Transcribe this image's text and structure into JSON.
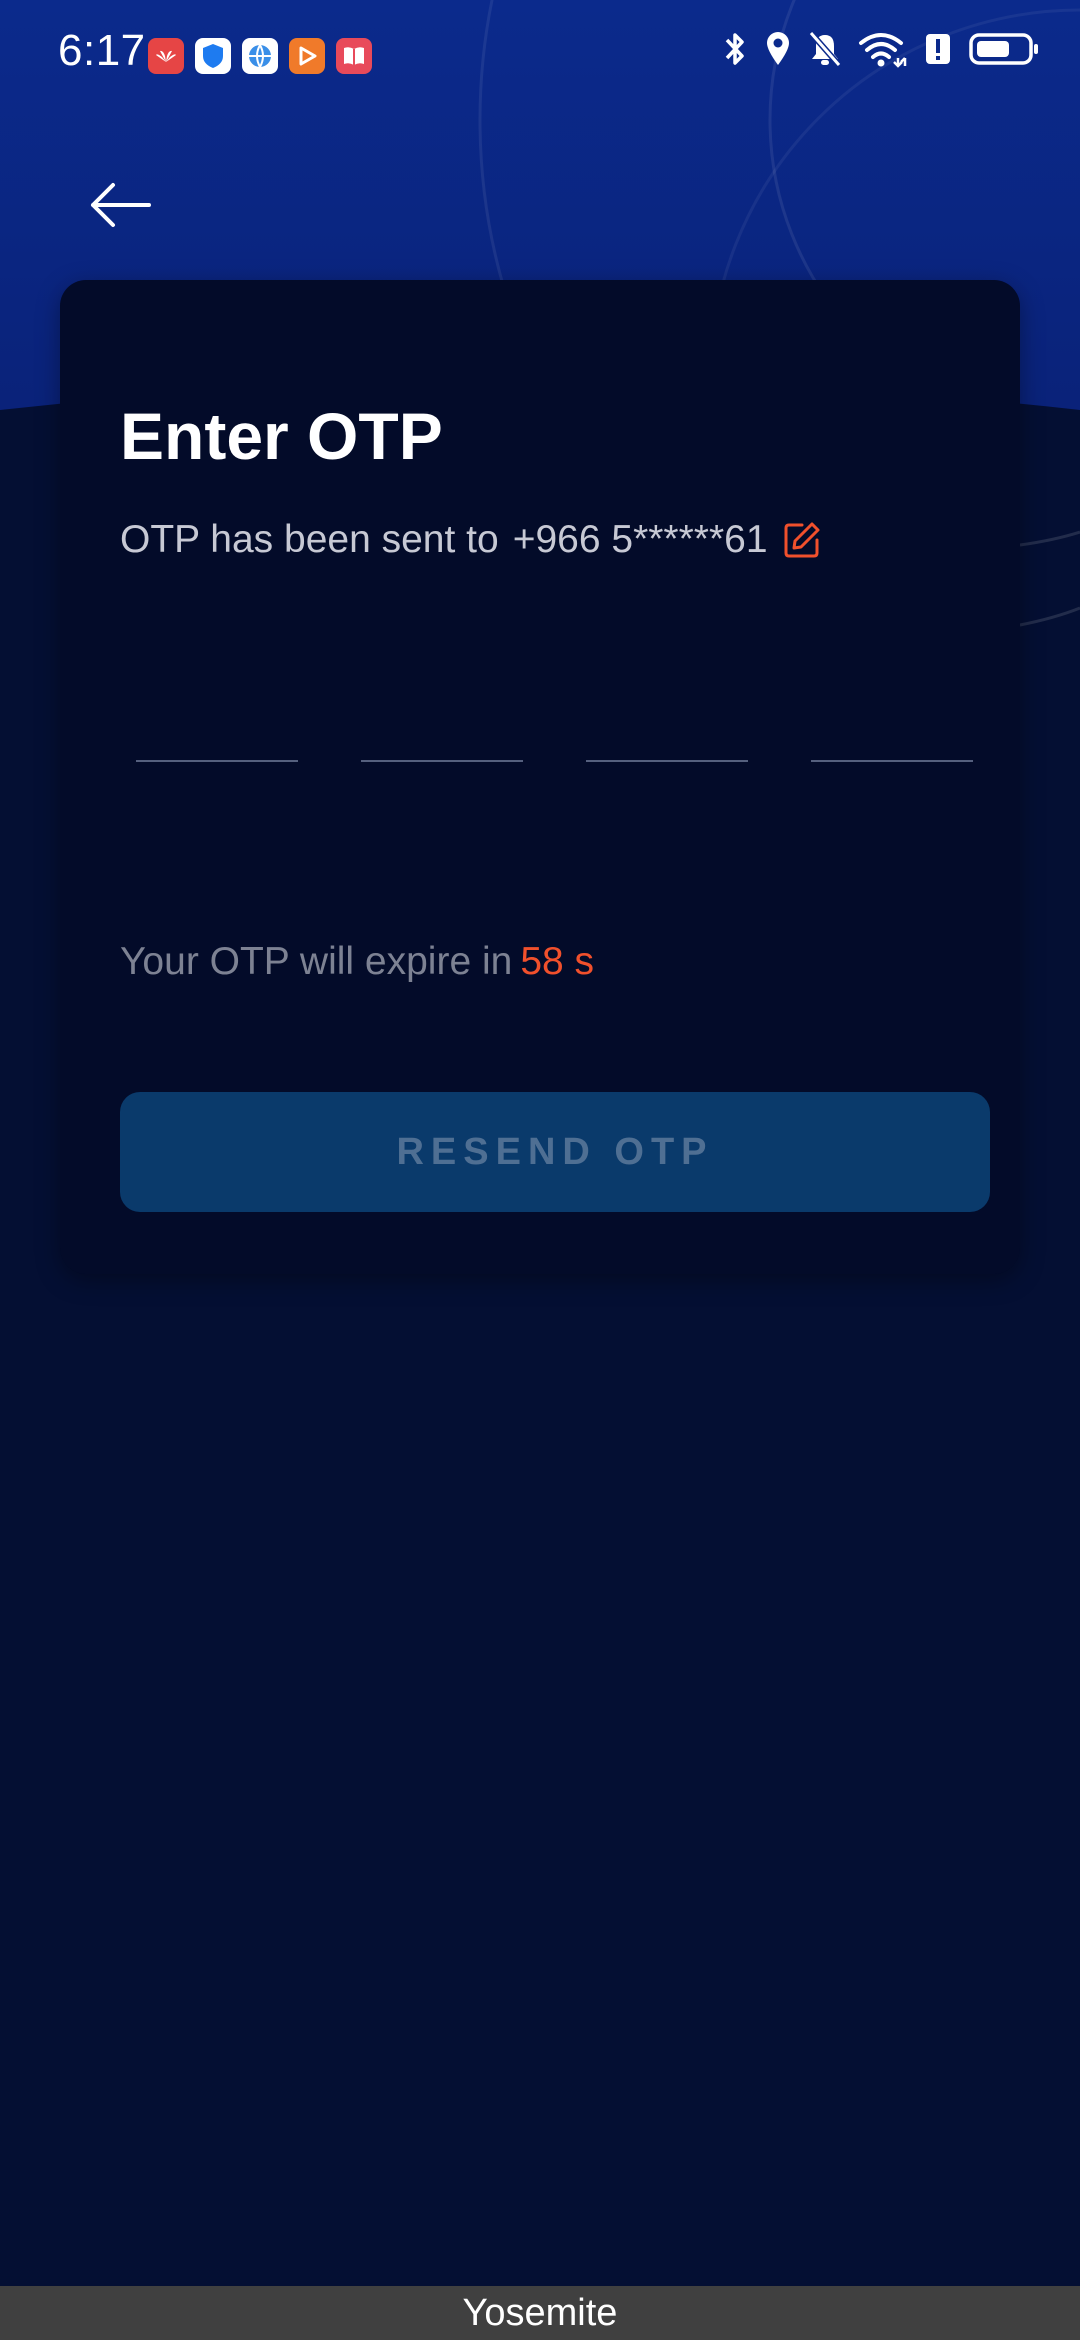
{
  "status_bar": {
    "time": "6:17",
    "app_icons": [
      {
        "name": "huawei-app-icon",
        "color": "#e64545"
      },
      {
        "name": "shield-app-icon",
        "color": "#1e7bf0"
      },
      {
        "name": "globe-app-icon",
        "color": "#3a8fe8"
      },
      {
        "name": "play-app-icon",
        "color": "#f07a2a"
      },
      {
        "name": "book-app-icon",
        "color": "#e84a5a"
      }
    ],
    "system_icons": [
      "bluetooth-icon",
      "location-icon",
      "bell-off-icon",
      "wifi-icon",
      "battery-alert-icon",
      "battery-icon"
    ]
  },
  "header": {
    "back_icon": "arrow-left-icon"
  },
  "card": {
    "title": "Enter OTP",
    "sent_prefix": "OTP has been sent to",
    "phone": "+966 5******61",
    "edit_icon": "edit-icon",
    "otp_boxes": [
      {
        "value": ""
      },
      {
        "value": ""
      },
      {
        "value": ""
      },
      {
        "value": ""
      }
    ],
    "expire_prefix": "Your OTP will expire in",
    "timer": "58 s",
    "resend_label": "RESEND OTP"
  },
  "colors": {
    "accent": "#f1502c",
    "background": "#040f33",
    "header_blue": "#0b2a8c",
    "button": "#0a3a6b"
  },
  "bottom_bar": {
    "label": "Yosemite"
  }
}
